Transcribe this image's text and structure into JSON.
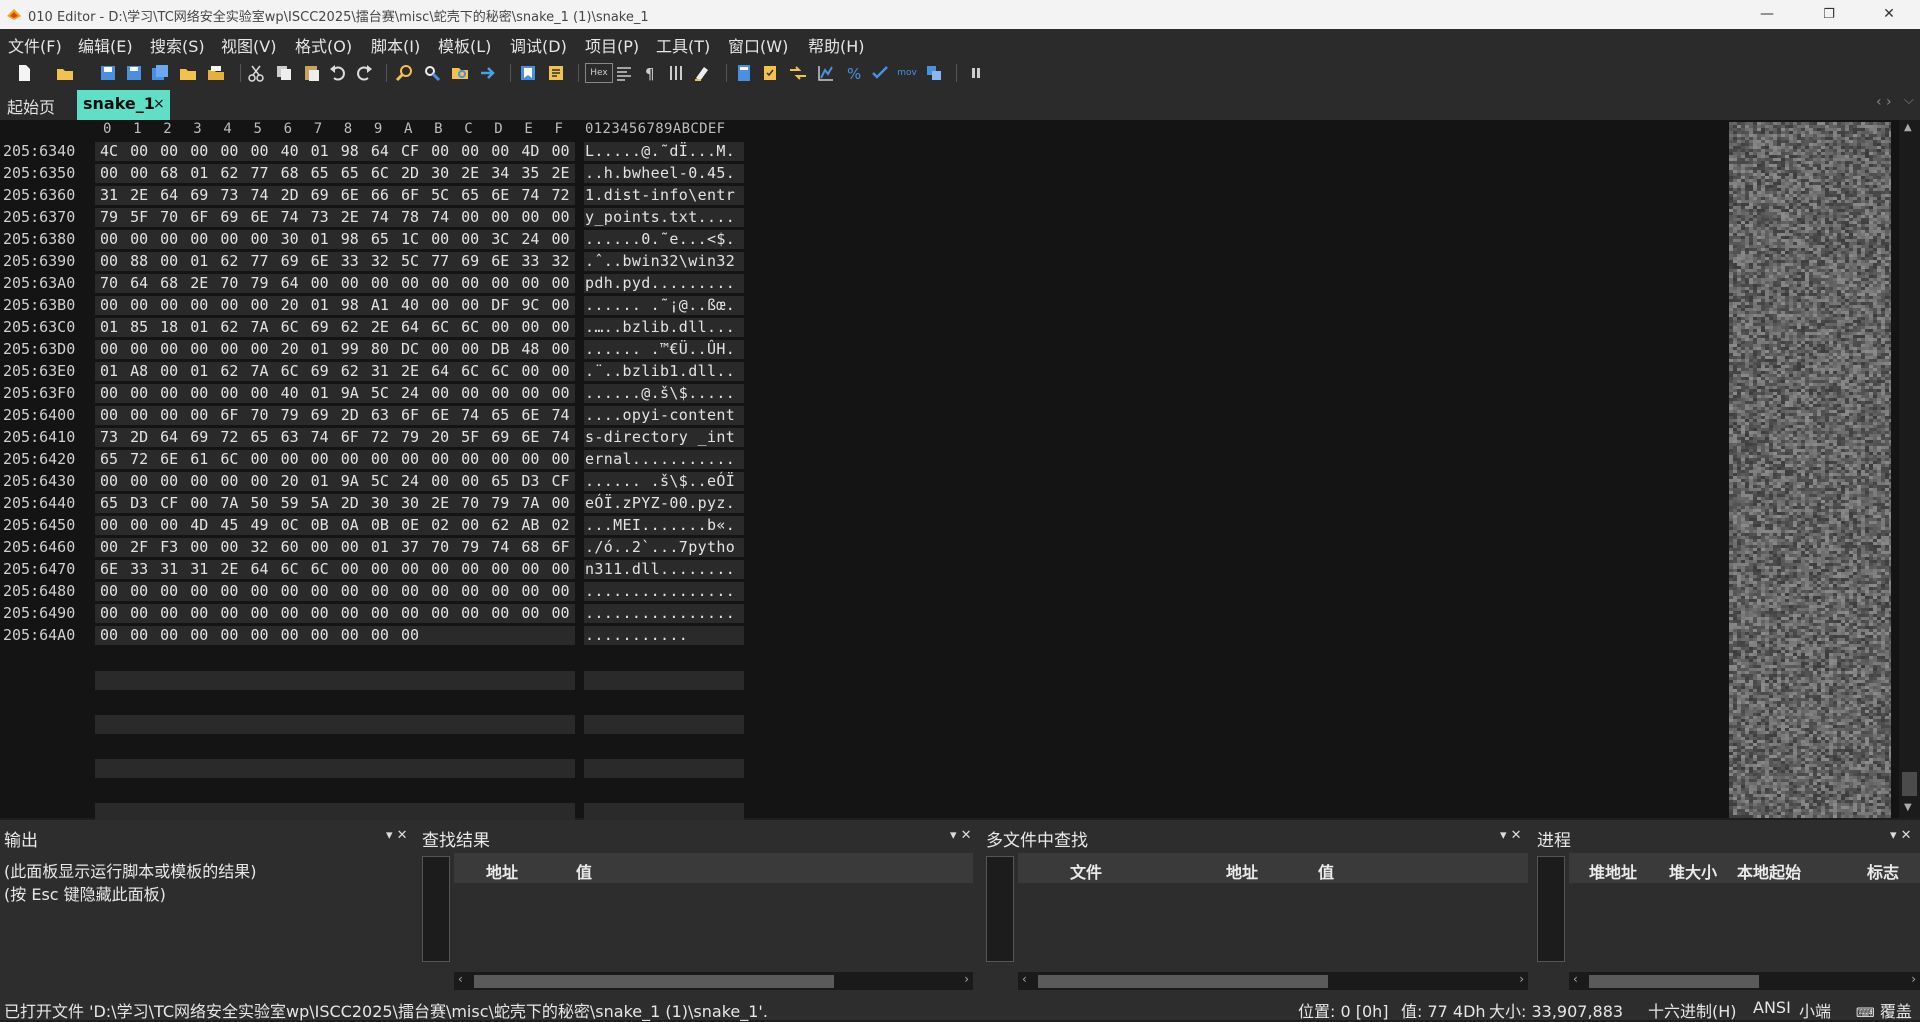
{
  "window": {
    "title": "010 Editor - D:\\学习\\TC网络安全实验室wp\\ISCC2025\\擂台赛\\misc\\蛇壳下的秘密\\snake_1 (1)\\snake_1",
    "minimize": "—",
    "restore": "❐",
    "close": "✕"
  },
  "menu": [
    "文件(F)",
    "编辑(E)",
    "搜索(S)",
    "视图(V)",
    "格式(O)",
    "脚本(I)",
    "模板(L)",
    "调试(D)",
    "项目(P)",
    "工具(T)",
    "窗口(W)",
    "帮助(H)"
  ],
  "toolbar": {
    "hex_label": "Hex",
    "mov_label": "mov"
  },
  "tabs": {
    "start": "起始页",
    "file": "snake_1",
    "close": "×",
    "nav": "‹ ›",
    "more": "⌵"
  },
  "editor": {
    "column_header": [
      "0",
      "1",
      "2",
      "3",
      "4",
      "5",
      "6",
      "7",
      "8",
      "9",
      "A",
      "B",
      "C",
      "D",
      "E",
      "F"
    ],
    "text_header": "0123456789ABCDEF",
    "rows": [
      {
        "addr": "205:6340",
        "hex": [
          "4C",
          "00",
          "00",
          "00",
          "00",
          "00",
          "40",
          "01",
          "98",
          "64",
          "CF",
          "00",
          "00",
          "00",
          "4D",
          "00"
        ],
        "text": "L.....@.˜dÏ...M."
      },
      {
        "addr": "205:6350",
        "hex": [
          "00",
          "00",
          "68",
          "01",
          "62",
          "77",
          "68",
          "65",
          "65",
          "6C",
          "2D",
          "30",
          "2E",
          "34",
          "35",
          "2E"
        ],
        "text": "..h.bwheel-0.45."
      },
      {
        "addr": "205:6360",
        "hex": [
          "31",
          "2E",
          "64",
          "69",
          "73",
          "74",
          "2D",
          "69",
          "6E",
          "66",
          "6F",
          "5C",
          "65",
          "6E",
          "74",
          "72"
        ],
        "text": "1.dist-info\\entr"
      },
      {
        "addr": "205:6370",
        "hex": [
          "79",
          "5F",
          "70",
          "6F",
          "69",
          "6E",
          "74",
          "73",
          "2E",
          "74",
          "78",
          "74",
          "00",
          "00",
          "00",
          "00"
        ],
        "text": "y_points.txt...."
      },
      {
        "addr": "205:6380",
        "hex": [
          "00",
          "00",
          "00",
          "00",
          "00",
          "00",
          "30",
          "01",
          "98",
          "65",
          "1C",
          "00",
          "00",
          "3C",
          "24",
          "00"
        ],
        "text": "......0.˜e...<$."
      },
      {
        "addr": "205:6390",
        "hex": [
          "00",
          "88",
          "00",
          "01",
          "62",
          "77",
          "69",
          "6E",
          "33",
          "32",
          "5C",
          "77",
          "69",
          "6E",
          "33",
          "32"
        ],
        "text": ".ˆ..bwin32\\win32"
      },
      {
        "addr": "205:63A0",
        "hex": [
          "70",
          "64",
          "68",
          "2E",
          "70",
          "79",
          "64",
          "00",
          "00",
          "00",
          "00",
          "00",
          "00",
          "00",
          "00",
          "00"
        ],
        "text": "pdh.pyd........."
      },
      {
        "addr": "205:63B0",
        "hex": [
          "00",
          "00",
          "00",
          "00",
          "00",
          "00",
          "20",
          "01",
          "98",
          "A1",
          "40",
          "00",
          "00",
          "DF",
          "9C",
          "00"
        ],
        "text": "...... .˜¡@..ßœ."
      },
      {
        "addr": "205:63C0",
        "hex": [
          "01",
          "85",
          "18",
          "01",
          "62",
          "7A",
          "6C",
          "69",
          "62",
          "2E",
          "64",
          "6C",
          "6C",
          "00",
          "00",
          "00"
        ],
        "text": ".…..bzlib.dll..."
      },
      {
        "addr": "205:63D0",
        "hex": [
          "00",
          "00",
          "00",
          "00",
          "00",
          "00",
          "20",
          "01",
          "99",
          "80",
          "DC",
          "00",
          "00",
          "DB",
          "48",
          "00"
        ],
        "text": "...... .™€Ü..ÛH."
      },
      {
        "addr": "205:63E0",
        "hex": [
          "01",
          "A8",
          "00",
          "01",
          "62",
          "7A",
          "6C",
          "69",
          "62",
          "31",
          "2E",
          "64",
          "6C",
          "6C",
          "00",
          "00"
        ],
        "text": ".¨..bzlib1.dll.."
      },
      {
        "addr": "205:63F0",
        "hex": [
          "00",
          "00",
          "00",
          "00",
          "00",
          "00",
          "40",
          "01",
          "9A",
          "5C",
          "24",
          "00",
          "00",
          "00",
          "00",
          "00"
        ],
        "text": "......@.š\\$....."
      },
      {
        "addr": "205:6400",
        "hex": [
          "00",
          "00",
          "00",
          "00",
          "6F",
          "70",
          "79",
          "69",
          "2D",
          "63",
          "6F",
          "6E",
          "74",
          "65",
          "6E",
          "74"
        ],
        "text": "....opyi-content"
      },
      {
        "addr": "205:6410",
        "hex": [
          "73",
          "2D",
          "64",
          "69",
          "72",
          "65",
          "63",
          "74",
          "6F",
          "72",
          "79",
          "20",
          "5F",
          "69",
          "6E",
          "74"
        ],
        "text": "s-directory _int"
      },
      {
        "addr": "205:6420",
        "hex": [
          "65",
          "72",
          "6E",
          "61",
          "6C",
          "00",
          "00",
          "00",
          "00",
          "00",
          "00",
          "00",
          "00",
          "00",
          "00",
          "00"
        ],
        "text": "ernal..........."
      },
      {
        "addr": "205:6430",
        "hex": [
          "00",
          "00",
          "00",
          "00",
          "00",
          "00",
          "20",
          "01",
          "9A",
          "5C",
          "24",
          "00",
          "00",
          "65",
          "D3",
          "CF"
        ],
        "text": "...... .š\\$..eÓÏ"
      },
      {
        "addr": "205:6440",
        "hex": [
          "65",
          "D3",
          "CF",
          "00",
          "7A",
          "50",
          "59",
          "5A",
          "2D",
          "30",
          "30",
          "2E",
          "70",
          "79",
          "7A",
          "00"
        ],
        "text": "eÓÏ.zPYZ-00.pyz."
      },
      {
        "addr": "205:6450",
        "hex": [
          "00",
          "00",
          "00",
          "4D",
          "45",
          "49",
          "0C",
          "0B",
          "0A",
          "0B",
          "0E",
          "02",
          "00",
          "62",
          "AB",
          "02"
        ],
        "text": "...MEI.......b«."
      },
      {
        "addr": "205:6460",
        "hex": [
          "00",
          "2F",
          "F3",
          "00",
          "00",
          "32",
          "60",
          "00",
          "00",
          "01",
          "37",
          "70",
          "79",
          "74",
          "68",
          "6F"
        ],
        "text": "./ó..2`...7pytho"
      },
      {
        "addr": "205:6470",
        "hex": [
          "6E",
          "33",
          "31",
          "31",
          "2E",
          "64",
          "6C",
          "6C",
          "00",
          "00",
          "00",
          "00",
          "00",
          "00",
          "00",
          "00"
        ],
        "text": "n311.dll........"
      },
      {
        "addr": "205:6480",
        "hex": [
          "00",
          "00",
          "00",
          "00",
          "00",
          "00",
          "00",
          "00",
          "00",
          "00",
          "00",
          "00",
          "00",
          "00",
          "00",
          "00"
        ],
        "text": "................"
      },
      {
        "addr": "205:6490",
        "hex": [
          "00",
          "00",
          "00",
          "00",
          "00",
          "00",
          "00",
          "00",
          "00",
          "00",
          "00",
          "00",
          "00",
          "00",
          "00",
          "00"
        ],
        "text": "................"
      },
      {
        "addr": "205:64A0",
        "hex": [
          "00",
          "00",
          "00",
          "00",
          "00",
          "00",
          "00",
          "00",
          "00",
          "00",
          "00"
        ],
        "text": "..........."
      }
    ]
  },
  "panels": {
    "output": {
      "title": "输出",
      "controls": "▾ ✕",
      "lines": [
        "(此面板显示运行脚本或模板的结果)",
        "(按 Esc 键隐藏此面板)"
      ]
    },
    "find_results": {
      "title": "查找结果",
      "controls": "▾ ✕",
      "columns": [
        "地址",
        "值"
      ]
    },
    "find_in_files": {
      "title": "多文件中查找",
      "controls": "▾ ✕",
      "columns": [
        "文件",
        "地址",
        "值"
      ]
    },
    "process": {
      "title": "进程",
      "controls": "▾ ✕",
      "columns": [
        "堆地址",
        "堆大小",
        "本地起始",
        "标志"
      ]
    }
  },
  "status": {
    "message": "已打开文件 'D:\\学习\\TC网络安全实验室wp\\ISCC2025\\擂台赛\\misc\\蛇壳下的秘密\\snake_1 (1)\\snake_1'.",
    "position": "位置: 0 [0h]",
    "value": "值: 77 4Dh",
    "size": "大小: 33,907,883",
    "mode": "十六进制(H)",
    "encoding": "ANSI",
    "endian": "小端",
    "overwrite": "覆盖"
  },
  "colors": {
    "tab_active": "#5fe0c6",
    "editor_bg": "#141414",
    "band": "#2a2a2a"
  }
}
